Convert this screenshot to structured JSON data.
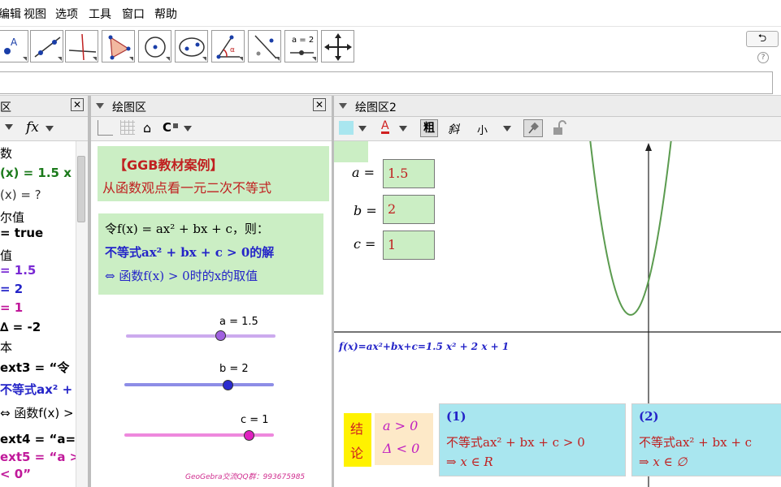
{
  "menu": [
    "编辑",
    "视图",
    "选项",
    "工具",
    "窗口",
    "帮助"
  ],
  "toolbar": {
    "tools": [
      "point-tool",
      "line-tool",
      "perpendicular-line-tool",
      "polygon-tool",
      "circle-tool",
      "conic-tool",
      "angle-tool",
      "reflect-tool",
      "slider-tool",
      "move-view-tool"
    ],
    "slider_tool_text": "a = 2",
    "undo_symbol": "⮌",
    "help_symbol": "?"
  },
  "algebra_panel": {
    "title": "区",
    "fx_button": "fx",
    "rows": [
      {
        "text": "数",
        "color": "#000000",
        "bold": false
      },
      {
        "text": "(x) = 1.5 x",
        "color": "#1b7a1b",
        "bold": true
      },
      {
        "text": "(x) = ?",
        "color": "#333333",
        "bold": false
      },
      {
        "text": "尔值",
        "color": "#000000",
        "bold": false
      },
      {
        "text": "= true",
        "color": "#000000",
        "bold": true
      },
      {
        "text": "值",
        "color": "#000000",
        "bold": false
      },
      {
        "text": "= 1.5",
        "color": "#7a2ad4",
        "bold": true
      },
      {
        "text": "= 2",
        "color": "#2424c8",
        "bold": true
      },
      {
        "text": "= 1",
        "color": "#c0189a",
        "bold": true
      },
      {
        "text": "∆ = -2",
        "color": "#000000",
        "bold": true
      },
      {
        "text": "本",
        "color": "#000000",
        "bold": false
      },
      {
        "text": "ext3 = “令",
        "color": "#000000",
        "bold": true
      },
      {
        "text": "不等式ax² +",
        "color": "#2424c8",
        "bold": true
      },
      {
        "text": "⇔ 函数f(x) >",
        "color": "#000000",
        "bold": false
      },
      {
        "text": "ext4 = “a=",
        "color": "#000000",
        "bold": true
      },
      {
        "text": "ext5 = “a >",
        "color": "#c0189a",
        "bold": true
      },
      {
        "text": "< 0”",
        "color": "#c0189a",
        "bold": true
      }
    ]
  },
  "graphics1": {
    "title": "绘图区",
    "box1_line1": "【GGB教材案例】",
    "box1_line2": "从函数观点看一元二次不等式",
    "box2_line1": "令f(x) = ax² + bx + c，则：",
    "box2_line2": "不等式ax² + bx + c > 0的解",
    "box2_line3": "⇔ 函数f(x) > 0时的x的取值",
    "slider_a_label": "a = 1.5",
    "slider_b_label": "b = 2",
    "slider_c_label": "c = 1",
    "slider_a_value": 1.5,
    "slider_b_value": 2,
    "slider_c_value": 1,
    "footer": "GeoGebra交流QQ群：993675985",
    "colors": {
      "a": "#a060e0",
      "b": "#2a2ad0",
      "c": "#e020c0"
    }
  },
  "graphics2": {
    "title": "绘图区2",
    "style_bold": "粗",
    "style_italic": "斜",
    "style_size": "小",
    "text_color_letter": "A",
    "a_label": "a =",
    "b_label": "b =",
    "c_label": "c =",
    "a_value": "1.5",
    "b_value": "2",
    "c_value": "1",
    "function_text": "f(x)=ax²+bx+c=1.5 x² + 2 x + 1",
    "conclusion_char1": "结",
    "conclusion_char2": "论",
    "cond1": "a > 0",
    "cond2": "Δ < 0",
    "case1_title": "(1)",
    "case1_line1": "不等式ax² + bx + c > 0",
    "case1_line2": "⇒ x ∈ R",
    "case2_title": "(2)",
    "case2_line1": "不等式ax² + bx + c",
    "case2_line2": "⇒ x ∈ ∅",
    "curve_color": "#5b9b4f"
  }
}
